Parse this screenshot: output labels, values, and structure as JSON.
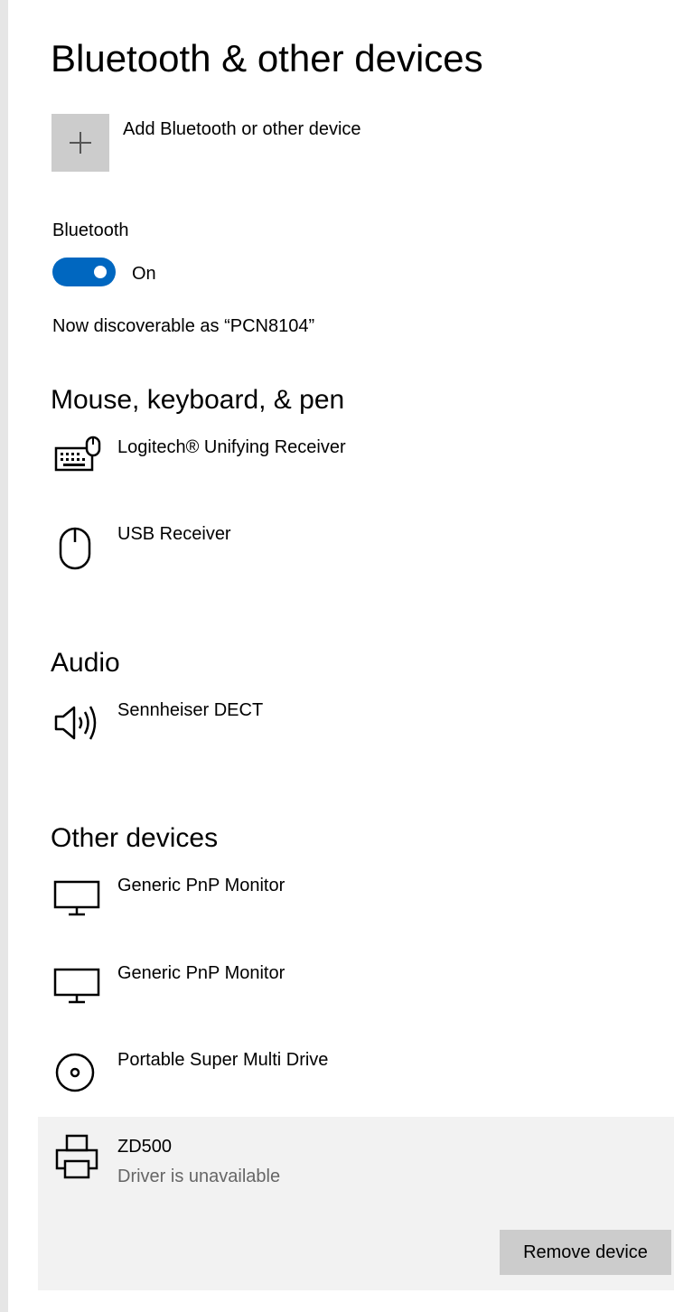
{
  "header": {
    "title": "Bluetooth & other devices"
  },
  "add_device": {
    "label": "Add Bluetooth or other device",
    "icon": "plus-icon"
  },
  "bluetooth": {
    "label": "Bluetooth",
    "state": "On",
    "toggle_on": true,
    "discoverable_text": "Now discoverable as “PCN8104”"
  },
  "sections": {
    "mouse_keyboard_pen": {
      "title": "Mouse, keyboard, & pen",
      "devices": [
        {
          "name": "Logitech® Unifying Receiver",
          "icon": "keyboard-icon"
        },
        {
          "name": "USB Receiver",
          "icon": "mouse-icon"
        }
      ]
    },
    "audio": {
      "title": "Audio",
      "devices": [
        {
          "name": "Sennheiser DECT",
          "icon": "speaker-icon"
        }
      ]
    },
    "other": {
      "title": "Other devices",
      "devices": [
        {
          "name": "Generic PnP Monitor",
          "icon": "monitor-icon"
        },
        {
          "name": "Generic PnP Monitor",
          "icon": "monitor-icon"
        },
        {
          "name": "Portable Super Multi Drive",
          "icon": "optical-drive-icon"
        },
        {
          "name": "ZD500",
          "status": "Driver is unavailable",
          "icon": "printer-icon",
          "selected": true
        }
      ]
    }
  },
  "actions": {
    "remove_device_label": "Remove device"
  },
  "colors": {
    "accent": "#0067c0",
    "tile_gray": "#cccccc",
    "selected_bg": "#f2f2f2",
    "secondary_text": "#666666",
    "rail": "#e6e6e6"
  }
}
